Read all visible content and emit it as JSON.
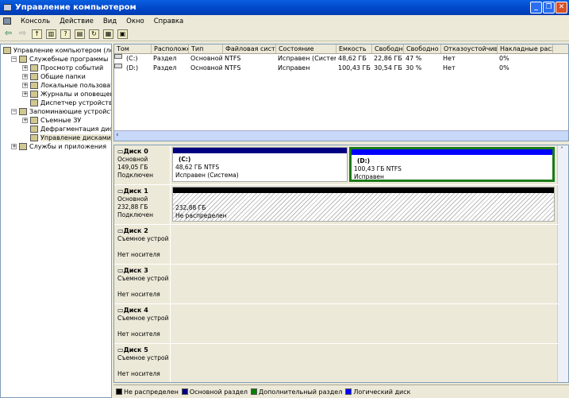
{
  "window": {
    "title": "Управление компьютером"
  },
  "menu": [
    "Консоль",
    "Действие",
    "Вид",
    "Окно",
    "Справка"
  ],
  "tree": [
    {
      "label": "Управление компьютером (локаль",
      "level": 0,
      "expander": ""
    },
    {
      "label": "Служебные программы",
      "level": 1,
      "expander": "−"
    },
    {
      "label": "Просмотр событий",
      "level": 2,
      "expander": "+"
    },
    {
      "label": "Общие папки",
      "level": 2,
      "expander": "+"
    },
    {
      "label": "Локальные пользователи",
      "level": 2,
      "expander": "+"
    },
    {
      "label": "Журналы и оповещения пр",
      "level": 2,
      "expander": "+"
    },
    {
      "label": "Диспетчер устройств",
      "level": 2,
      "expander": ""
    },
    {
      "label": "Запоминающие устройства",
      "level": 1,
      "expander": "−"
    },
    {
      "label": "Съемные ЗУ",
      "level": 2,
      "expander": "+"
    },
    {
      "label": "Дефрагментация диска",
      "level": 2,
      "expander": ""
    },
    {
      "label": "Управление дисками",
      "level": 2,
      "expander": "",
      "selected": true
    },
    {
      "label": "Службы и приложения",
      "level": 1,
      "expander": "+"
    }
  ],
  "volumes": {
    "columns": [
      "Том",
      "Расположение",
      "Тип",
      "Файловая система",
      "Состояние",
      "Емкость",
      "Свободно",
      "Свободно %",
      "Отказоустойчивость",
      "Накладные расх"
    ],
    "rows": [
      [
        "(C:)",
        "Раздел",
        "Основной",
        "NTFS",
        "Исправен (Система)",
        "48,62 ГБ",
        "22,86 ГБ",
        "47 %",
        "Нет",
        "0%"
      ],
      [
        "(D:)",
        "Раздел",
        "Основной",
        "NTFS",
        "Исправен",
        "100,43 ГБ",
        "30,54 ГБ",
        "30 %",
        "Нет",
        "0%"
      ]
    ]
  },
  "disks": [
    {
      "name": "Диск 0",
      "type": "Основной",
      "size": "149,05 ГБ",
      "status": "Подключен",
      "partitions": [
        {
          "label": "(C:)",
          "size": "48,62 ГБ NTFS",
          "status": "Исправен (Система)",
          "color": "#000080"
        },
        {
          "label": "(D:)",
          "size": "100,43 ГБ NTFS",
          "status": "Исправен",
          "color": "#0000ff",
          "selected": true
        }
      ]
    },
    {
      "name": "Диск 1",
      "type": "Основной",
      "size": "232,88 ГБ",
      "status": "Подключен",
      "partitions": [
        {
          "label": "",
          "size": "232,88 ГБ",
          "status": "Не распределен",
          "color": "#000000",
          "unallocated": true
        }
      ]
    },
    {
      "name": "Диск 2",
      "type": "Съемное устрой",
      "size": "",
      "status": "Нет носителя",
      "partitions": []
    },
    {
      "name": "Диск 3",
      "type": "Съемное устрой",
      "size": "",
      "status": "Нет носителя",
      "partitions": []
    },
    {
      "name": "Диск 4",
      "type": "Съемное устрой",
      "size": "",
      "status": "Нет носителя",
      "partitions": []
    },
    {
      "name": "Диск 5",
      "type": "Съемное устрой",
      "size": "",
      "status": "Нет носителя",
      "partitions": []
    }
  ],
  "legend": [
    {
      "label": "Не распределен",
      "color": "#000000"
    },
    {
      "label": "Основной раздел",
      "color": "#000080"
    },
    {
      "label": "Дополнительный раздел",
      "color": "#008000"
    },
    {
      "label": "Логический диск",
      "color": "#0000ff"
    }
  ]
}
